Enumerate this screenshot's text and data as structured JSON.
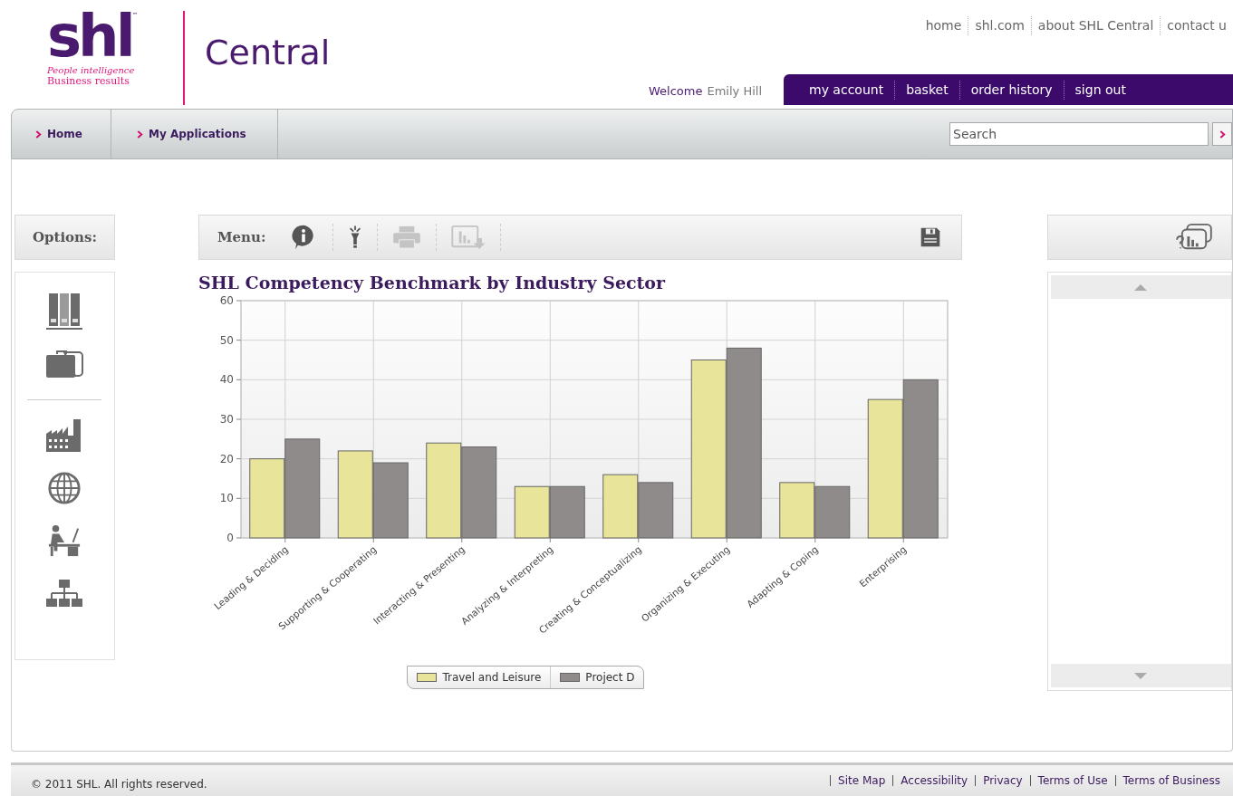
{
  "logo": {
    "mark": "shl",
    "trademark": "™",
    "tagline_1": "People intelligence",
    "tagline_2": "Business results",
    "product": "Central"
  },
  "top_links": [
    "home",
    "shl.com",
    "about SHL Central",
    "contact u"
  ],
  "welcome": {
    "label": "Welcome",
    "user_name": "Emily Hill"
  },
  "account_tabs": [
    "my account",
    "basket",
    "order history",
    "sign out"
  ],
  "nav": [
    "Home",
    "My Applications"
  ],
  "search": {
    "placeholder": "Search"
  },
  "options": {
    "label": "Options:",
    "groups": [
      [
        {
          "kind": "binders"
        },
        {
          "kind": "briefcase"
        }
      ],
      [
        {
          "kind": "factory"
        },
        {
          "kind": "globe"
        },
        {
          "kind": "desk"
        },
        {
          "kind": "hierarchy"
        }
      ]
    ]
  },
  "menu": {
    "label": "Menu:",
    "tools": [
      {
        "kind": "info",
        "disabled": false
      },
      {
        "kind": "wand",
        "disabled": false
      },
      {
        "kind": "print",
        "disabled": true
      },
      {
        "kind": "export",
        "disabled": true
      }
    ],
    "save": {
      "kind": "save",
      "disabled": false
    }
  },
  "report": {
    "title": "SHL Competency Benchmark by Industry Sector",
    "chart_data": {
      "type": "bar",
      "categories": [
        "Leading & Deciding",
        "Supporting & Cooperating",
        "Interacting & Presenting",
        "Analyzing & Interpreting",
        "Creating & Conceptualizing",
        "Organizing & Executing",
        "Adapting & Coping",
        "Enterprising"
      ],
      "series": [
        {
          "name": "Travel and Leisure",
          "color": "#e8e49a",
          "values": [
            20,
            22,
            24,
            13,
            16,
            45,
            14,
            35
          ]
        },
        {
          "name": "Project D",
          "color": "#8f8b8a",
          "values": [
            25,
            19,
            23,
            13,
            14,
            48,
            13,
            40
          ]
        }
      ],
      "ylim": [
        0,
        60
      ],
      "yticks": [
        0,
        10,
        20,
        30,
        40,
        50,
        60
      ],
      "grid": true,
      "legend": "bottom"
    }
  },
  "footer": {
    "copyright": "© 2011 SHL. All rights reserved.",
    "links": [
      "Site Map",
      "Accessibility",
      "Privacy",
      "Terms of Use",
      "Terms of Business"
    ]
  }
}
